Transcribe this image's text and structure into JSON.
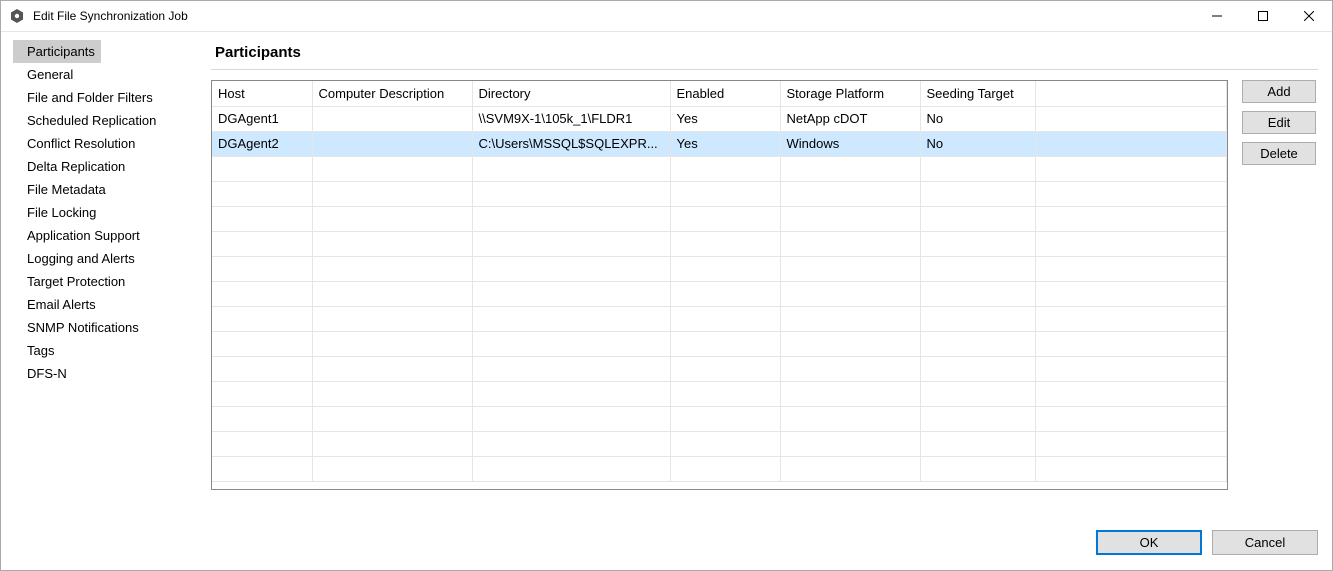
{
  "window": {
    "title": "Edit File Synchronization Job"
  },
  "sidebar": {
    "items": [
      {
        "label": "Participants",
        "selected": true
      },
      {
        "label": "General"
      },
      {
        "label": "File and Folder Filters"
      },
      {
        "label": "Scheduled Replication"
      },
      {
        "label": "Conflict Resolution"
      },
      {
        "label": "Delta Replication"
      },
      {
        "label": "File Metadata"
      },
      {
        "label": "File Locking"
      },
      {
        "label": "Application Support"
      },
      {
        "label": "Logging and Alerts"
      },
      {
        "label": "Target Protection"
      },
      {
        "label": "Email Alerts"
      },
      {
        "label": "SNMP Notifications"
      },
      {
        "label": "Tags"
      },
      {
        "label": "DFS-N"
      }
    ]
  },
  "main": {
    "title": "Participants",
    "columns": {
      "host": "Host",
      "desc": "Computer Description",
      "dir": "Directory",
      "enabled": "Enabled",
      "platform": "Storage Platform",
      "seeding": "Seeding Target"
    },
    "rows": [
      {
        "host": "DGAgent1",
        "desc": "",
        "dir": "\\\\SVM9X-1\\105k_1\\FLDR1",
        "enabled": "Yes",
        "platform": "NetApp cDOT",
        "seeding": "No",
        "selected": false
      },
      {
        "host": "DGAgent2",
        "desc": "",
        "dir": "C:\\Users\\MSSQL$SQLEXPR...",
        "enabled": "Yes",
        "platform": "Windows",
        "seeding": "No",
        "selected": true
      }
    ],
    "empty_row_count": 13
  },
  "actions": {
    "add": "Add",
    "edit": "Edit",
    "delete": "Delete"
  },
  "footer": {
    "ok": "OK",
    "cancel": "Cancel"
  }
}
